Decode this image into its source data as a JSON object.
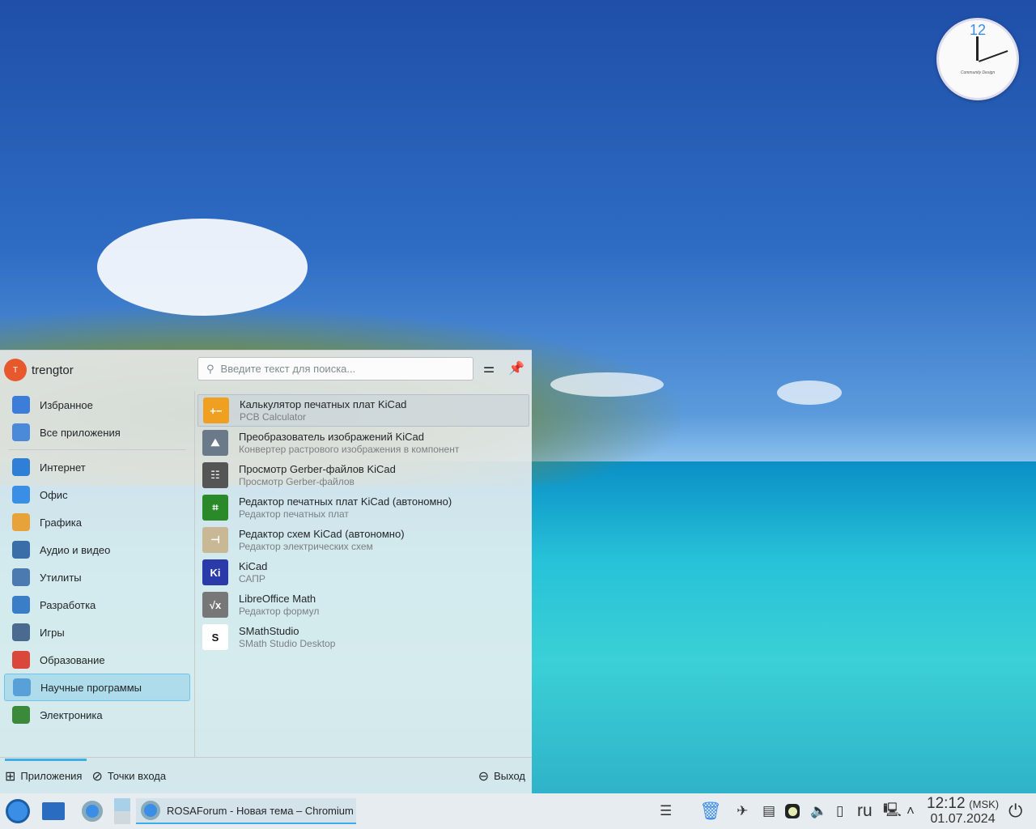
{
  "desktop": {
    "clock_widget": {
      "number": "12",
      "brand": "Community Design"
    }
  },
  "menu": {
    "user": {
      "initial": "T",
      "name": "trengtor"
    },
    "search": {
      "placeholder": "Введите текст для поиска..."
    },
    "categories": [
      {
        "label": "Избранное",
        "icon": "bookmark-icon",
        "color": "#3b7dd8"
      },
      {
        "label": "Все приложения",
        "icon": "grid-icon",
        "color": "#4a8ad8"
      },
      {
        "label": "Интернет",
        "icon": "globe-icon",
        "color": "#2f7fd6"
      },
      {
        "label": "Офис",
        "icon": "office-icon",
        "color": "#3a8ee6"
      },
      {
        "label": "Графика",
        "icon": "graphics-icon",
        "color": "#e8a23a"
      },
      {
        "label": "Аудио и видео",
        "icon": "headphones-icon",
        "color": "#3a6ea8"
      },
      {
        "label": "Утилиты",
        "icon": "sliders-icon",
        "color": "#4a7ab0"
      },
      {
        "label": "Разработка",
        "icon": "code-icon",
        "color": "#3a7ec8"
      },
      {
        "label": "Игры",
        "icon": "gamepad-icon",
        "color": "#4a6a90"
      },
      {
        "label": "Образование",
        "icon": "book-icon",
        "color": "#d9483b"
      },
      {
        "label": "Научные программы",
        "icon": "atom-icon",
        "color": "#5aa0d8"
      },
      {
        "label": "Электроника",
        "icon": "electronics-icon",
        "color": "#3a8a3a"
      }
    ],
    "selected_category": "Научные программы",
    "apps": [
      {
        "name": "Калькулятор печатных плат KiCad",
        "desc": "PCB Calculator",
        "icon": "calculator-icon",
        "color": "#f0a020",
        "glyph": "+−"
      },
      {
        "name": "Преобразователь изображений KiCad",
        "desc": "Конвертер растрового изображения в компонент",
        "icon": "image-converter-icon",
        "color": "#6a7a8a",
        "glyph": "⛰"
      },
      {
        "name": "Просмотр Gerber-файлов KiCad",
        "desc": "Просмотр Gerber-файлов",
        "icon": "gerber-icon",
        "color": "#555",
        "glyph": "☷"
      },
      {
        "name": "Редактор печатных плат KiCad (автономно)",
        "desc": "Редактор печатных плат",
        "icon": "pcb-icon",
        "color": "#2a8a2a",
        "glyph": "⌗"
      },
      {
        "name": "Редактор схем KiCad (автономно)",
        "desc": "Редактор электрических схем",
        "icon": "schematic-icon",
        "color": "#c8b896",
        "glyph": "⊣"
      },
      {
        "name": "KiCad",
        "desc": "САПР",
        "icon": "kicad-icon",
        "color": "#2a3aa8",
        "glyph": "Ki"
      },
      {
        "name": "LibreOffice Math",
        "desc": "Редактор формул",
        "icon": "libreoffice-math-icon",
        "color": "#777",
        "glyph": "√x"
      },
      {
        "name": "SMathStudio",
        "desc": "SMath Studio Desktop",
        "icon": "smath-icon",
        "color": "#fff",
        "glyph": "S"
      }
    ],
    "footer": {
      "applications": "Приложения",
      "places": "Точки входа",
      "logout": "Выход"
    }
  },
  "taskbar": {
    "window_title": "ROSAForum - Новая тема – Chromium",
    "keyboard_layout": "ru",
    "time": "12:12",
    "timezone": "(MSK)",
    "date": "01.07.2024"
  }
}
